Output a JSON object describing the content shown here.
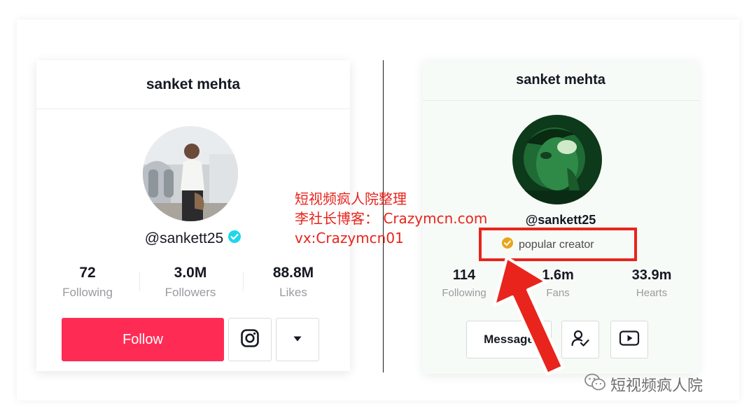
{
  "left_profile": {
    "name": "sanket mehta",
    "handle": "@sankett25",
    "stats": [
      {
        "value": "72",
        "label": "Following"
      },
      {
        "value": "3.0M",
        "label": "Followers"
      },
      {
        "value": "88.8M",
        "label": "Likes"
      }
    ],
    "follow_label": "Follow",
    "icons": [
      "instagram-icon",
      "caret-down-icon",
      "verified-icon"
    ]
  },
  "right_profile": {
    "name": "sanket mehta",
    "handle": "@sankett25",
    "badge_label": "popular creator",
    "stats": [
      {
        "value": "114",
        "label": "Following"
      },
      {
        "value": "1.6m",
        "label": "Fans"
      },
      {
        "value": "33.9m",
        "label": "Hearts"
      }
    ],
    "message_label": "Message",
    "icons": [
      "user-check-icon",
      "youtube-icon",
      "popular-badge-icon"
    ]
  },
  "overlay_text": {
    "line1": "短视频疯人院整理",
    "line2": "李社长博客： Crazymcn.com",
    "line3": "vx:Crazymcn01"
  },
  "watermark": {
    "label": "短视频疯人院"
  },
  "colors": {
    "follow_red": "#fe2c55",
    "annotation_red": "#e8241c",
    "verified_blue": "#20d5ec",
    "badge_gold": "#e8a51a"
  }
}
